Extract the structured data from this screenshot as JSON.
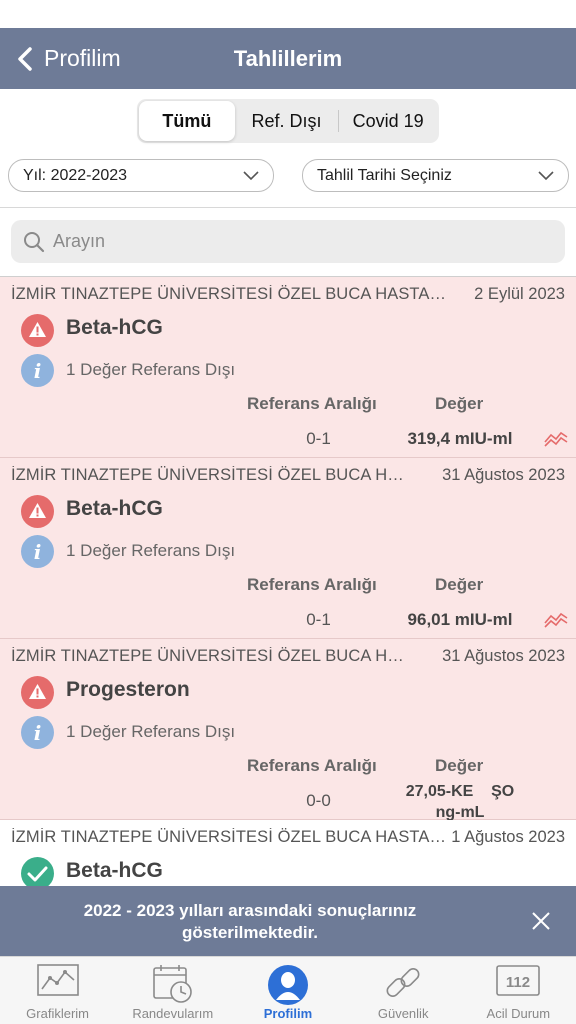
{
  "nav": {
    "back_label": "Profilim",
    "title": "Tahlillerim"
  },
  "segments": [
    {
      "label": "Tümü",
      "active": true
    },
    {
      "label": "Ref. Dışı",
      "active": false
    },
    {
      "label": "Covid 19",
      "active": false
    }
  ],
  "filters": {
    "year": "Yıl: 2022-2023",
    "date": "Tahlil Tarihi Seçiniz"
  },
  "search": {
    "placeholder": "Arayın"
  },
  "columns": {
    "reference": "Referans Aralığı",
    "value": "Değer"
  },
  "results": [
    {
      "hospital": "İZMİR TINAZTEPE ÜNİVERSİTESİ ÖZEL BUCA HASTANESİ",
      "date": "2 Eylül 2023",
      "test": "Beta-hCG",
      "status": "warning-icon",
      "info": "1 Değer Referans Dışı",
      "reference": "0-1",
      "value": "319,4 mIU-ml"
    },
    {
      "hospital": "İZMİR TINAZTEPE ÜNİVERSİTESİ ÖZEL BUCA HASTANESİ",
      "date": "31 Ağustos 2023",
      "test": "Beta-hCG",
      "status": "warning-icon",
      "info": "1 Değer Referans Dışı",
      "reference": "0-1",
      "value": "96,01 mIU-ml"
    },
    {
      "hospital": "İZMİR TINAZTEPE ÜNİVERSİTESİ ÖZEL BUCA HASTANESİ",
      "date": "31 Ağustos 2023",
      "test": "Progesteron",
      "status": "warning-icon",
      "info": "1 Değer Referans Dışı",
      "reference": "0-0",
      "value_line1": "27,05-KE    ŞO",
      "value_line2": "ng-mL"
    },
    {
      "hospital": "İZMİR TINAZTEPE ÜNİVERSİTESİ ÖZEL BUCA HASTANESİ",
      "date": "1 Ağustos 2023",
      "test": "Beta-hCG",
      "status": "check-icon"
    }
  ],
  "banner": {
    "text": "2022 - 2023 yılları arasındaki sonuçlarınız gösterilmektedir."
  },
  "tabs": [
    {
      "label": "Grafiklerim",
      "icon": "chart-icon",
      "active": false
    },
    {
      "label": "Randevularım",
      "icon": "calendar-clock-icon",
      "active": false
    },
    {
      "label": "Profilim",
      "icon": "person-icon",
      "active": true
    },
    {
      "label": "Güvenlik",
      "icon": "link-icon",
      "active": false
    },
    {
      "label": "Acil Durum",
      "icon": "emergency-112-icon",
      "badge": "112",
      "active": false
    }
  ],
  "colors": {
    "header": "#6e7b97",
    "alert_row": "#fbe6e6",
    "warning": "#e56b6b",
    "info": "#8fb3dd",
    "ok": "#3aae8a",
    "active_tab": "#2d6fd6"
  }
}
